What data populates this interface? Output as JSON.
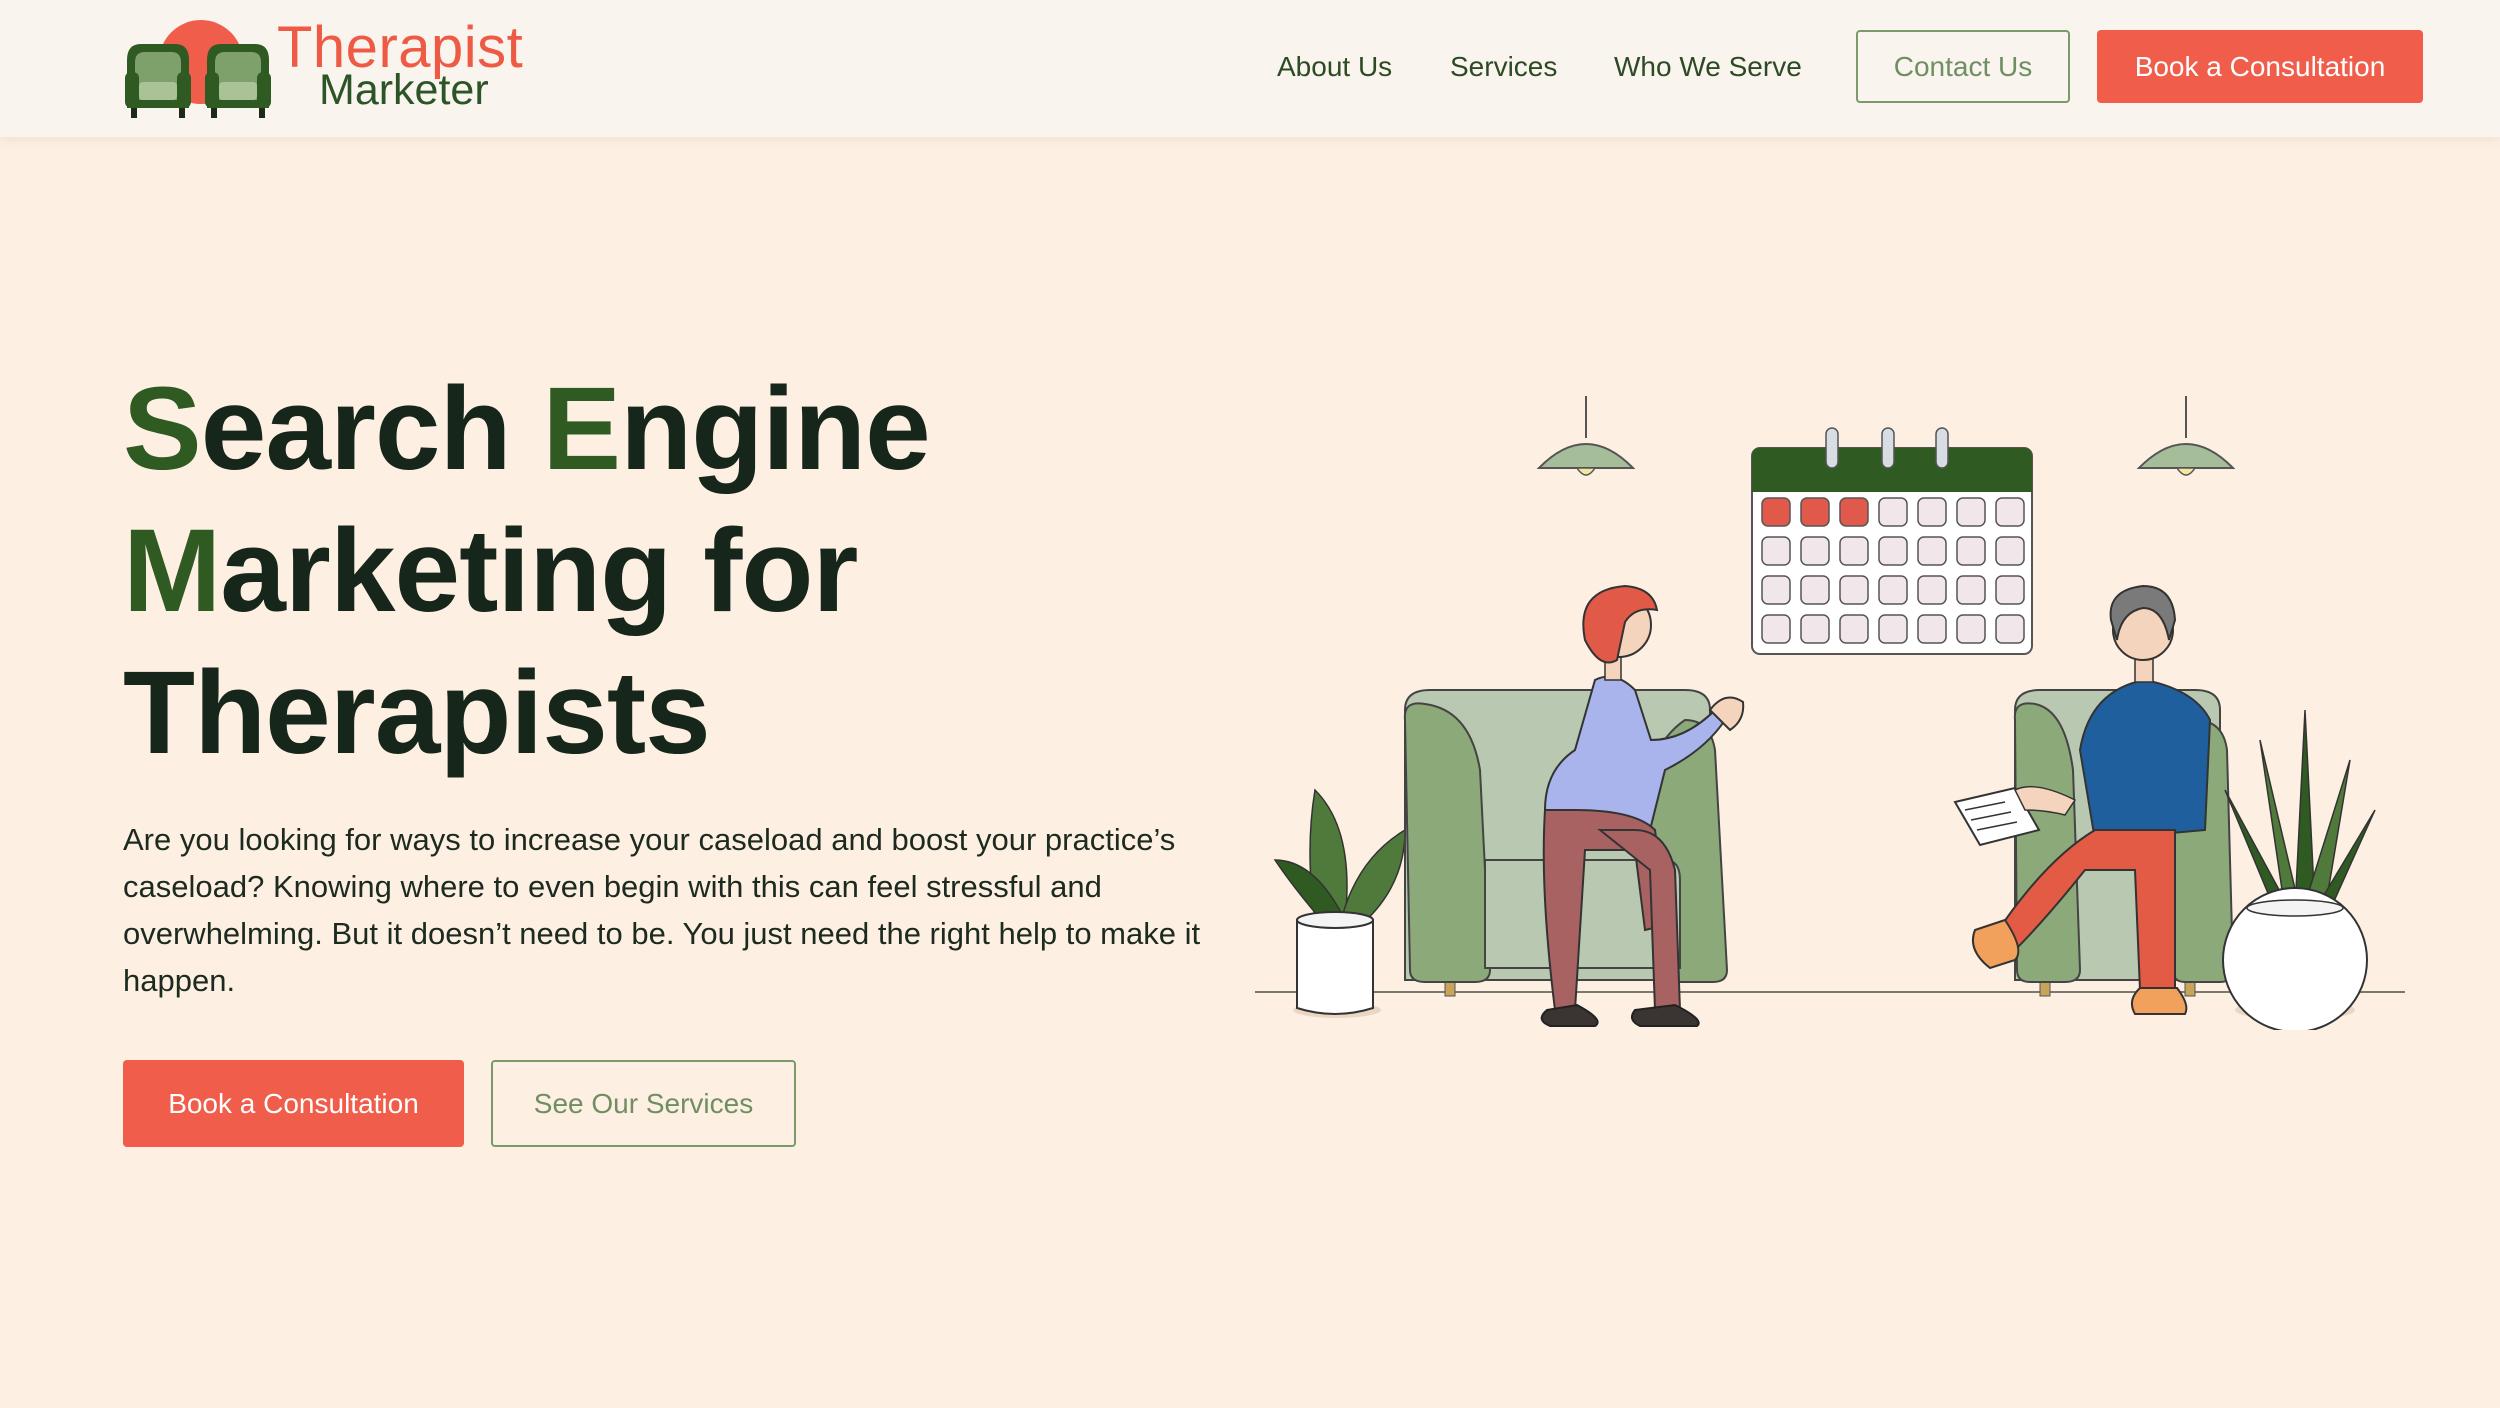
{
  "colors": {
    "page_bg": "#fdf0e3",
    "header_bg": "#f9f4ee",
    "brand_coral": "#f05d4a",
    "brand_green": "#2f5a22",
    "heading_dark": "#17261a",
    "outline_green": "#7a9a6c"
  },
  "logo": {
    "line1": "Therapist",
    "line2": "Marketer",
    "icon": "armchairs-logo-icon"
  },
  "nav": {
    "items": [
      {
        "label": "About Us"
      },
      {
        "label": "Services"
      },
      {
        "label": "Who We Serve"
      }
    ],
    "contact_label": "Contact Us",
    "consult_label": "Book a Consultation"
  },
  "hero": {
    "title_lines": [
      [
        {
          "accent": "S",
          "rest": "earch "
        },
        {
          "accent": "E",
          "rest": "ngine"
        }
      ],
      [
        {
          "accent": "M",
          "rest": "arketing for"
        }
      ],
      [
        {
          "accent": "",
          "rest": "Therapists"
        }
      ]
    ],
    "description": "Are you looking for ways to increase your caseload and boost your practice’s caseload? Knowing where to even begin with this can feel stressful and overwhelming. But it doesn’t need to be. You just need the right help to make it happen.",
    "primary_cta": "Book a Consultation",
    "secondary_cta": "See Our Services"
  },
  "illustration": {
    "name": "therapy-session-illustration",
    "calendar_filled_days": 3,
    "calendar_total_days": 28
  }
}
